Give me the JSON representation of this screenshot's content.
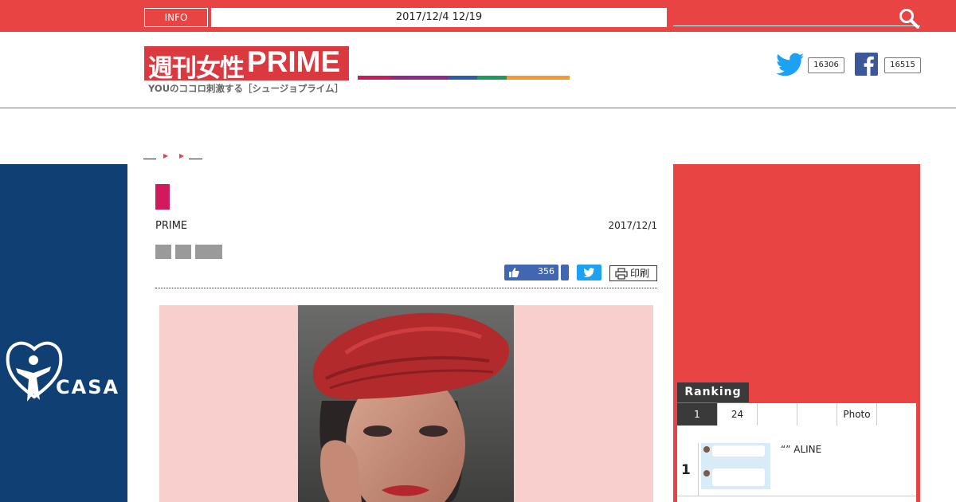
{
  "topbar": {
    "info_label": "INFO",
    "datetime": "2017/12/4 12/19"
  },
  "header": {
    "logo_jp": "週刊女性",
    "logo_en": "PRIME",
    "tagline": "YOUのココロ刺激する［シュージョプライム］",
    "stripe_colors": [
      "#c41d5a",
      "#8c2a8c",
      "#2a5fa8",
      "#1d9a5a",
      "#f29a30"
    ],
    "twitter_count": "16306",
    "facebook_count": "16515"
  },
  "left_ad": {
    "brand": "CASA"
  },
  "article": {
    "source": "PRIME",
    "date": "2017/12/1",
    "like_count": "356",
    "print_label": "印刷"
  },
  "ranking": {
    "title": "Ranking",
    "tabs": [
      "1",
      "24",
      "",
      "",
      "Photo",
      ""
    ],
    "items": [
      {
        "rank": "1",
        "title": "“” ALINE"
      }
    ]
  },
  "colors": {
    "brand_red": "#e84444",
    "casa_navy": "#0f3f73",
    "category_pink": "#d2195c"
  }
}
